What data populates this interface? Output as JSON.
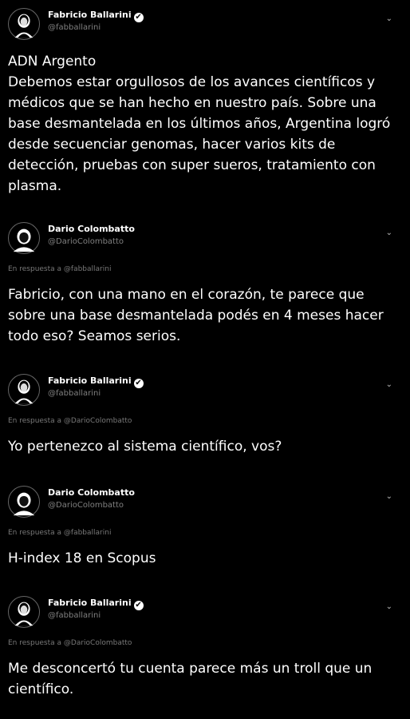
{
  "tweets": [
    {
      "name": "Fabricio Ballarini",
      "handle": "@fabballarini",
      "verified": true,
      "reply_to": "",
      "text": "ADN Argento\nDebemos estar orgullosos de los avances científicos y médicos que se han hecho en nuestro país. Sobre una base desmantelada en los últimos años, Argentina logró desde secuenciar genomas, hacer varios kits de detección, pruebas con super sueros, tratamiento con plasma."
    },
    {
      "name": "Dario Colombatto",
      "handle": "@DarioColombatto",
      "verified": false,
      "reply_to": "En respuesta a @fabballarini",
      "text": "Fabricio, con una mano en el corazón, te parece que sobre una base desmantelada podés en 4 meses hacer todo eso? Seamos serios."
    },
    {
      "name": "Fabricio Ballarini",
      "handle": "@fabballarini",
      "verified": true,
      "reply_to": "En respuesta a @DarioColombatto",
      "text": "Yo pertenezco al sistema científico, vos?"
    },
    {
      "name": "Dario Colombatto",
      "handle": "@DarioColombatto",
      "verified": false,
      "reply_to": "En respuesta a @fabballarini",
      "text": "H-index 18 en Scopus"
    },
    {
      "name": "Fabricio Ballarini",
      "handle": "@fabballarini",
      "verified": true,
      "reply_to": "En respuesta a @DarioColombatto",
      "text": "Me desconcertó tu cuenta parece más un troll que un científico."
    }
  ],
  "icons": {
    "verified": "✔",
    "chevron": "⌄"
  }
}
